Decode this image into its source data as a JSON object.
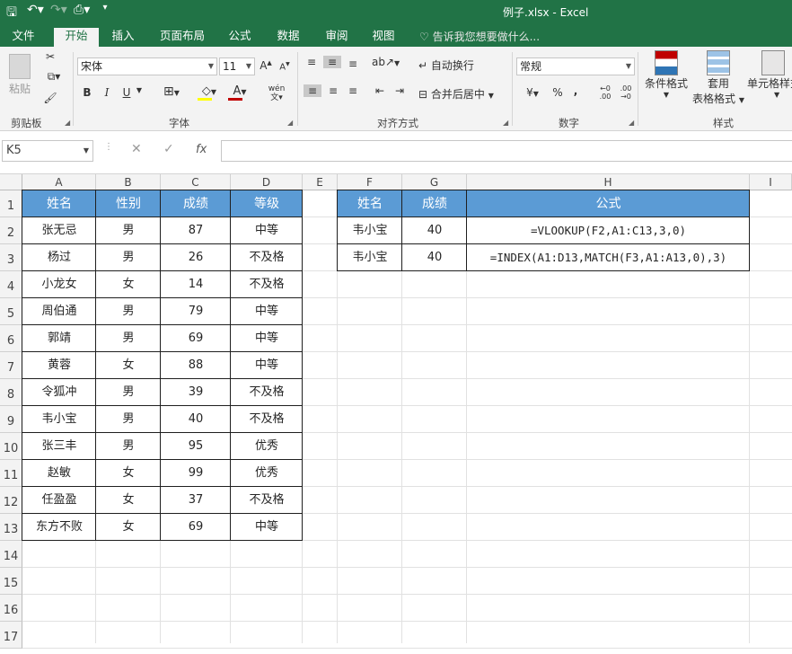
{
  "window": {
    "title": "例子.xlsx - Excel"
  },
  "tabs": [
    "文件",
    "开始",
    "插入",
    "页面布局",
    "公式",
    "数据",
    "审阅",
    "视图"
  ],
  "active_tab": "开始",
  "tell_me": "告诉我您想要做什么...",
  "ribbon": {
    "clipboard": {
      "paste": "粘贴",
      "label": "剪贴板"
    },
    "font": {
      "name": "宋体",
      "size": "11",
      "label": "字体",
      "bold": "B",
      "italic": "I",
      "underline": "U",
      "phonetic": "wén"
    },
    "alignment": {
      "wrap": "自动换行",
      "merge": "合并后居中",
      "label": "对齐方式"
    },
    "number": {
      "format": "常规",
      "percent": "%",
      "comma": ",",
      "label": "数字"
    },
    "styles": {
      "conditional": "条件格式",
      "table_format_1": "套用",
      "table_format_2": "表格格式",
      "cell_styles": "单元格样式",
      "label": "样式"
    }
  },
  "formula_bar": {
    "name_box": "K5",
    "fx": "fx",
    "value": ""
  },
  "columns": [
    "A",
    "B",
    "C",
    "D",
    "E",
    "F",
    "G",
    "H",
    "I"
  ],
  "rows": [
    "1",
    "2",
    "3",
    "4",
    "5",
    "6",
    "7",
    "8",
    "9",
    "10",
    "11",
    "12",
    "13",
    "14",
    "15",
    "16",
    "17"
  ],
  "table1": {
    "headers": [
      "姓名",
      "性别",
      "成绩",
      "等级"
    ],
    "rows": [
      [
        "张无忌",
        "男",
        "87",
        "中等"
      ],
      [
        "杨过",
        "男",
        "26",
        "不及格"
      ],
      [
        "小龙女",
        "女",
        "14",
        "不及格"
      ],
      [
        "周伯通",
        "男",
        "79",
        "中等"
      ],
      [
        "郭靖",
        "男",
        "69",
        "中等"
      ],
      [
        "黄蓉",
        "女",
        "88",
        "中等"
      ],
      [
        "令狐冲",
        "男",
        "39",
        "不及格"
      ],
      [
        "韦小宝",
        "男",
        "40",
        "不及格"
      ],
      [
        "张三丰",
        "男",
        "95",
        "优秀"
      ],
      [
        "赵敏",
        "女",
        "99",
        "优秀"
      ],
      [
        "任盈盈",
        "女",
        "37",
        "不及格"
      ],
      [
        "东方不败",
        "女",
        "69",
        "中等"
      ]
    ]
  },
  "table2": {
    "headers": [
      "姓名",
      "成绩",
      "公式"
    ],
    "rows": [
      [
        "韦小宝",
        "40",
        "=VLOOKUP(F2,A1:C13,3,0)"
      ],
      [
        "韦小宝",
        "40",
        "=INDEX(A1:D13,MATCH(F3,A1:A13,0),3)"
      ]
    ]
  },
  "colors": {
    "excel_green": "#217346",
    "header_fill": "#5b9bd5"
  }
}
